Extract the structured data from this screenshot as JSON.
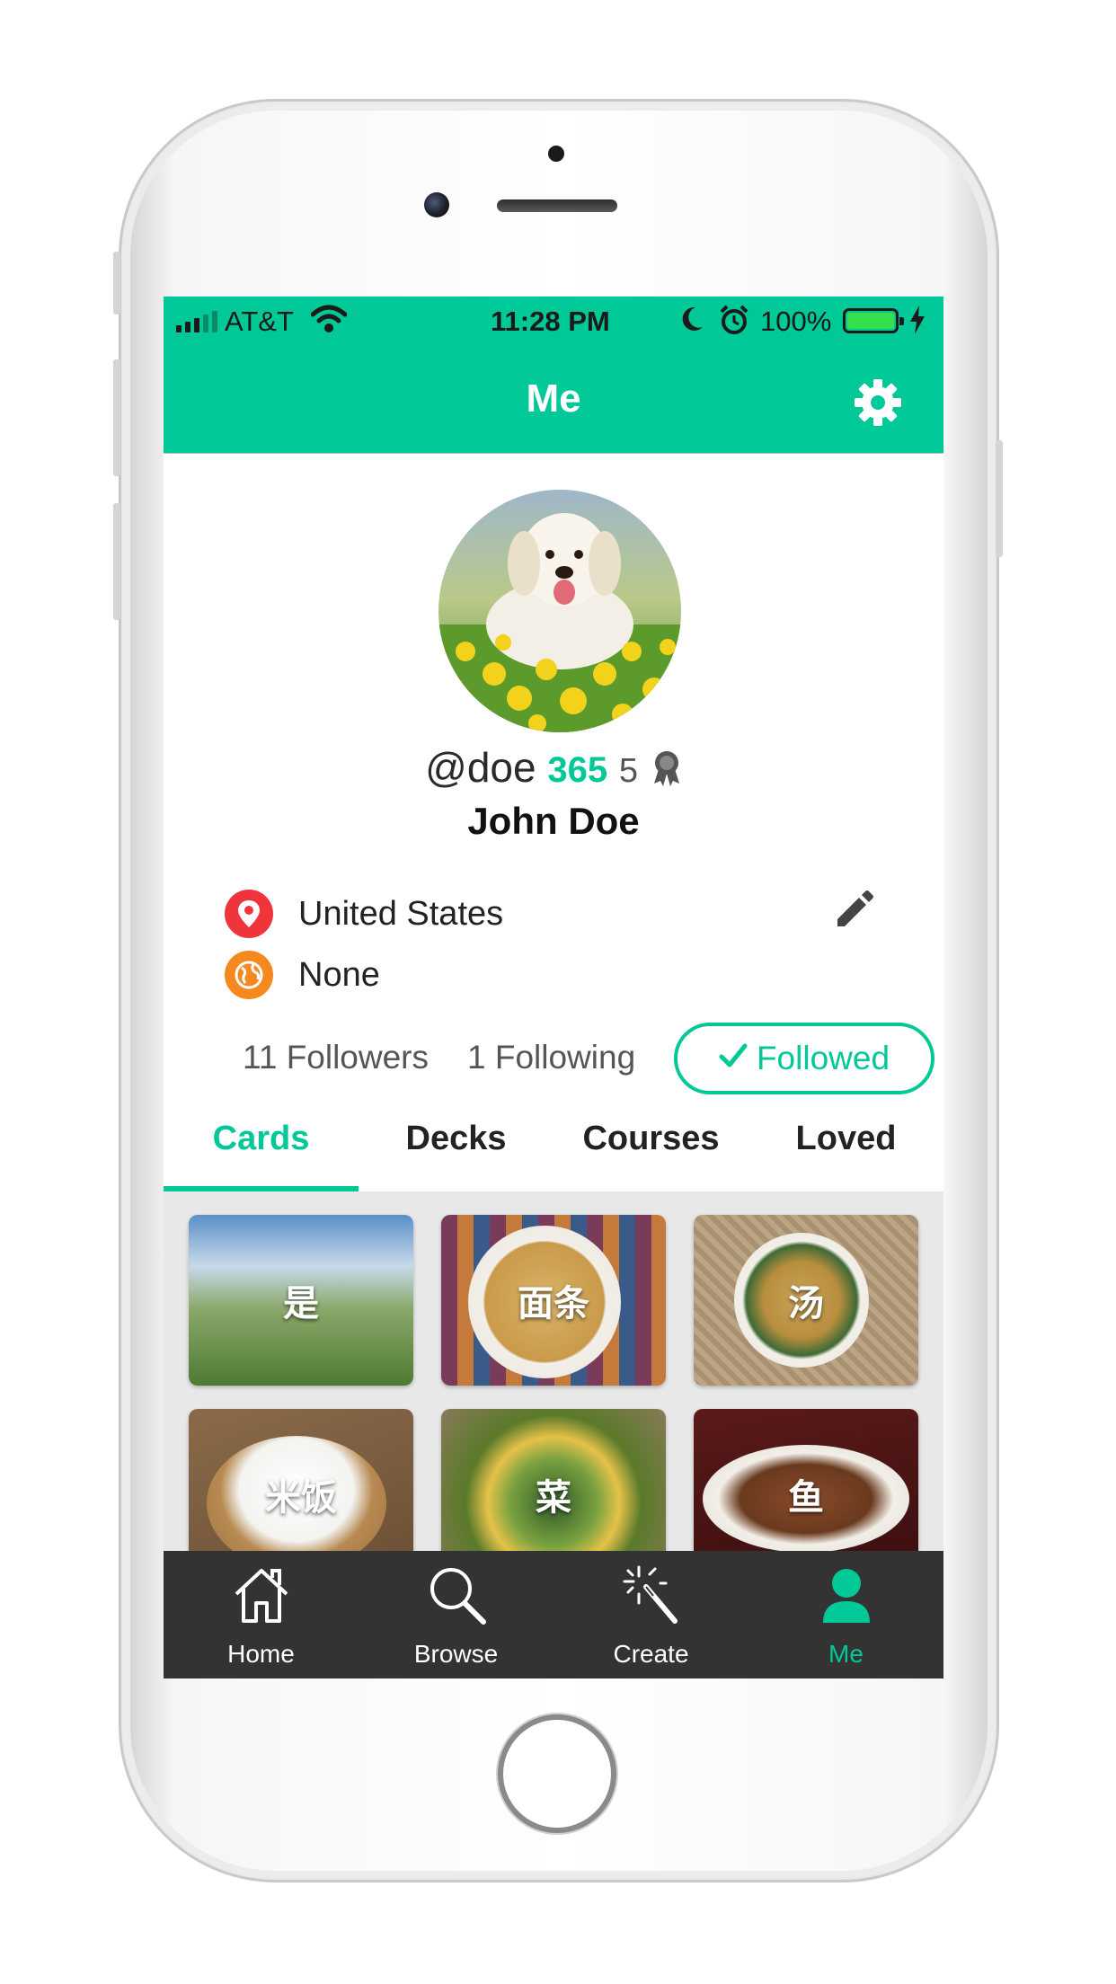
{
  "status_bar": {
    "carrier": "AT&T",
    "time": "11:28 PM",
    "battery_percent": "100%",
    "battery_level": 1.0,
    "icons": [
      "signal-icon",
      "wifi-icon",
      "moon-icon",
      "alarm-icon",
      "battery-icon",
      "charging-bolt-icon"
    ]
  },
  "header": {
    "title": "Me",
    "settings_icon": "gear-icon"
  },
  "profile": {
    "username": "@doe",
    "streak": "365",
    "badge_count": "5",
    "badge_icon": "medal-icon",
    "full_name": "John Doe",
    "location": "United States",
    "location_icon": "map-pin-icon",
    "language": "None",
    "language_icon": "globe-icon",
    "edit_icon": "pencil-icon"
  },
  "social": {
    "followers": "11 Followers",
    "following": "1 Following",
    "followed_label": "Followed"
  },
  "tabs": [
    {
      "label": "Cards",
      "active": true
    },
    {
      "label": "Decks",
      "active": false
    },
    {
      "label": "Courses",
      "active": false
    },
    {
      "label": "Loved",
      "active": false
    }
  ],
  "cards": [
    {
      "label": "是"
    },
    {
      "label": "面条"
    },
    {
      "label": "汤"
    },
    {
      "label": "米饭"
    },
    {
      "label": "菜"
    },
    {
      "label": "鱼"
    }
  ],
  "tabbar": [
    {
      "label": "Home",
      "icon": "home-icon",
      "active": false
    },
    {
      "label": "Browse",
      "icon": "search-icon",
      "active": false
    },
    {
      "label": "Create",
      "icon": "magic-wand-icon",
      "active": false
    },
    {
      "label": "Me",
      "icon": "person-icon",
      "active": true
    }
  ],
  "colors": {
    "accent": "#00c896",
    "tabbar_bg": "#333333",
    "location_pin": "#f0343c",
    "globe": "#f5891f"
  }
}
